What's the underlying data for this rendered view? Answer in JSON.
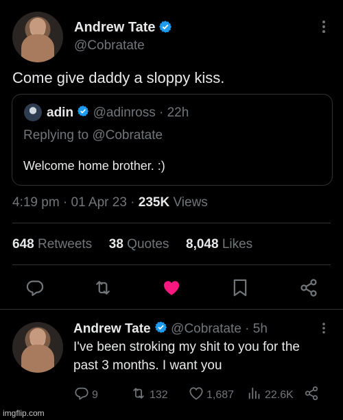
{
  "main_tweet": {
    "author_name": "Andrew Tate",
    "author_handle": "@Cobratate",
    "text": "Come give daddy a sloppy kiss.",
    "timestamp": "4:19 pm · 01 Apr 23 · ",
    "views_count": "235K",
    "views_label": " Views"
  },
  "quoted_tweet": {
    "author_name": "adin",
    "author_handle": "@adinross",
    "time": " · 22h",
    "replying_to": "Replying to @Cobratate",
    "text": "Welcome home brother. :)"
  },
  "stats": {
    "retweets_count": "648",
    "retweets_label": " Retweets",
    "quotes_count": "38",
    "quotes_label": " Quotes",
    "likes_count": "8,048",
    "likes_label": " Likes"
  },
  "reply_tweet": {
    "author_name": "Andrew Tate",
    "author_handle": "@Cobratate",
    "time": " · 5h",
    "text_line1": "I've been stroking my shit to you for the",
    "text_line2": "past 3 months. I want you",
    "replies": "9",
    "retweets": "132",
    "likes": "1,687",
    "views": "22.6K"
  },
  "watermark": "imgflip.com",
  "colors": {
    "verified": "#1d9bf0",
    "like": "#f91880",
    "muted": "#71767b"
  },
  "icons": [
    "more-icon",
    "verified-badge-icon",
    "reply-icon",
    "retweet-icon",
    "like-heart-icon",
    "bookmark-icon",
    "share-icon",
    "views-icon"
  ]
}
